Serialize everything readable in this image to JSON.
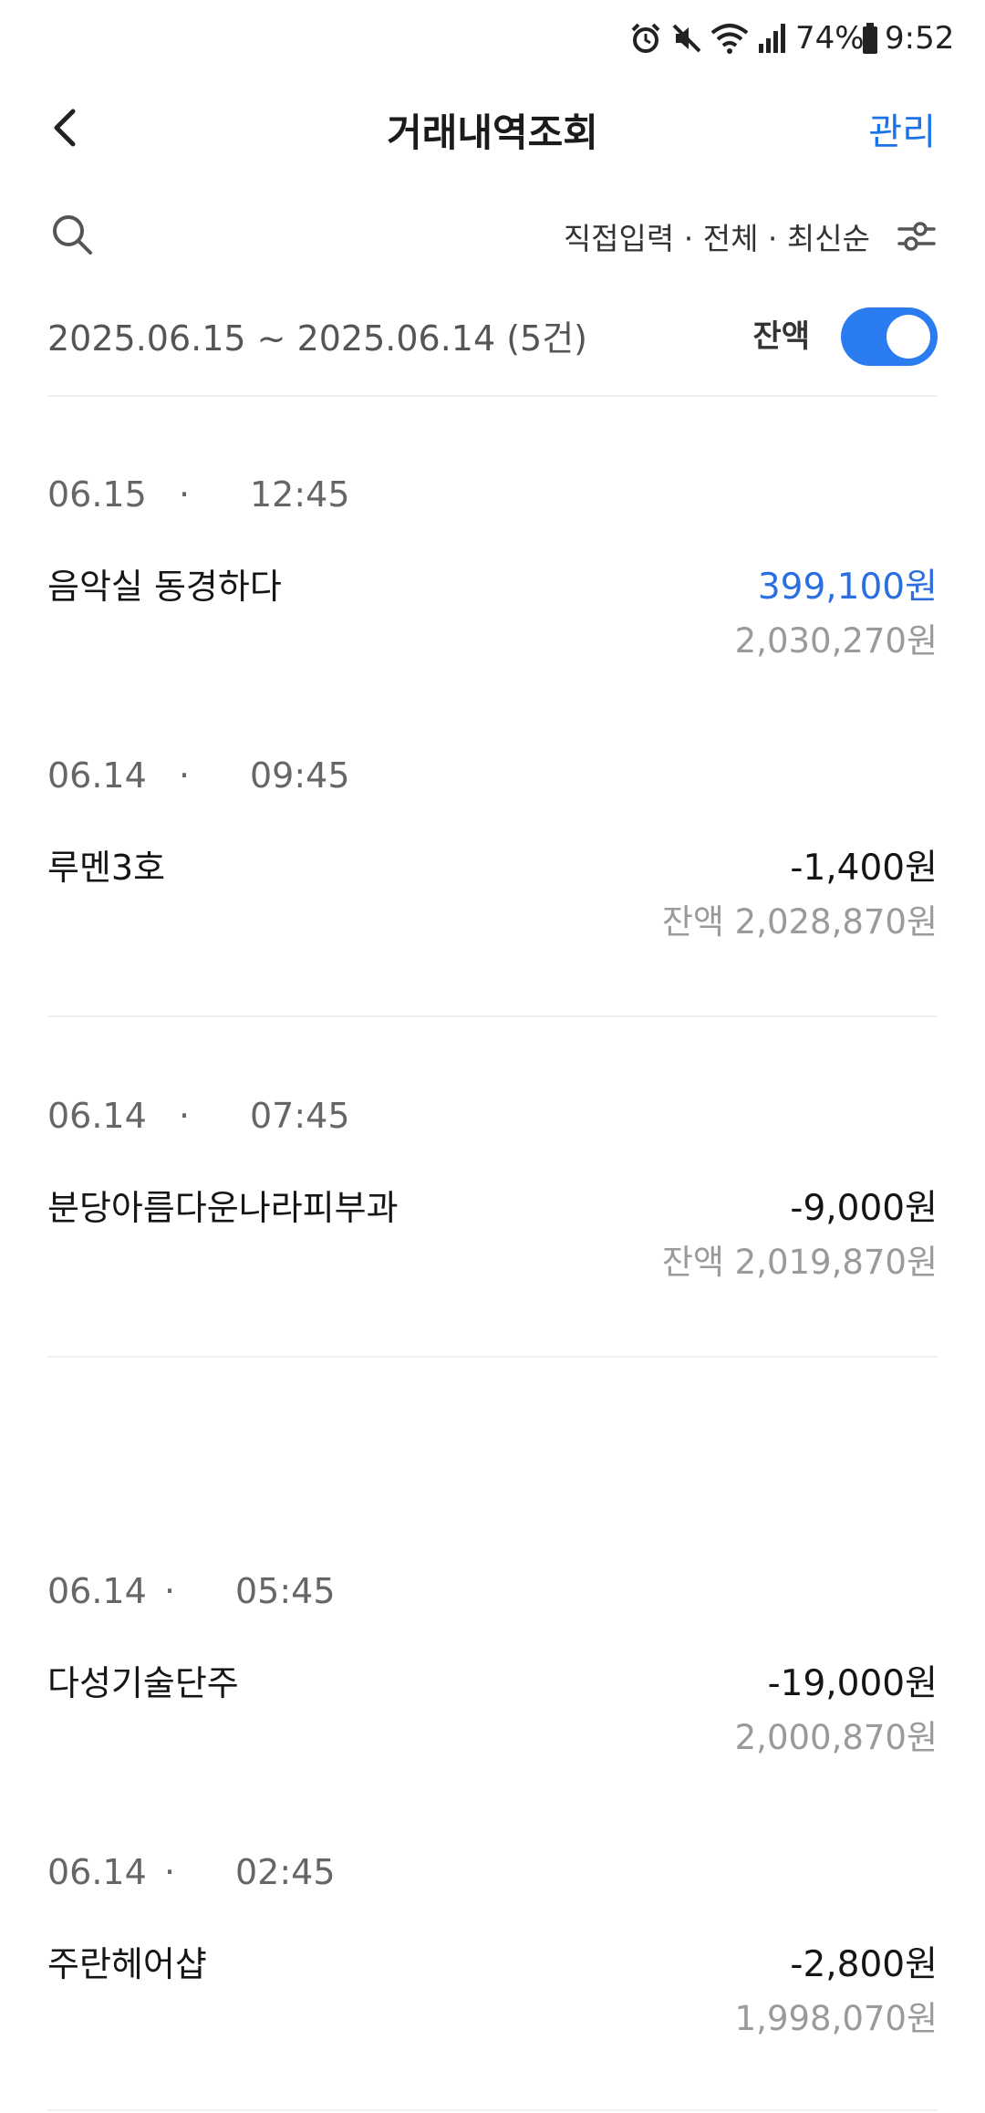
{
  "status_bar": {
    "battery": "74%",
    "time": "9:52",
    "icons": [
      "alarm-icon",
      "mute-icon",
      "wifi-icon",
      "signal-icon",
      "battery-icon"
    ]
  },
  "header": {
    "title": "거래내역조회",
    "manage_label": "관리",
    "accent_color": "#1a73e8"
  },
  "filter": {
    "summary": "직접입력 · 전체 · 최신순"
  },
  "period": {
    "range": "2025.06.15 ~ 2025.06.14 (5건)",
    "balance_toggle_label": "잔액",
    "balance_toggle_on": true
  },
  "transactions": [
    {
      "date": "06.15",
      "time": "12:45",
      "name": "음악실 동경하다",
      "amount": "399,100원",
      "balance": "2,030,270원",
      "direction": "in"
    },
    {
      "date": "06.14",
      "time": "09:45",
      "name": "루멘3호",
      "amount": "-1,400원",
      "balance": "잔액 2,028,870원",
      "direction": "out"
    },
    {
      "date": "06.14",
      "time": "07:45",
      "name": "분당아름다운나라피부과",
      "amount": "-9,000원",
      "balance": "잔액 2,019,870원",
      "direction": "out"
    },
    {
      "date": "06.14",
      "time": "05:45",
      "name": "다성기술단주",
      "amount": "-19,000원",
      "balance": "2,000,870원",
      "direction": "out"
    },
    {
      "date": "06.14",
      "time": "02:45",
      "name": "주란헤어샵",
      "amount": "-2,800원",
      "balance": "1,998,070원",
      "direction": "out"
    }
  ],
  "dot": "·"
}
